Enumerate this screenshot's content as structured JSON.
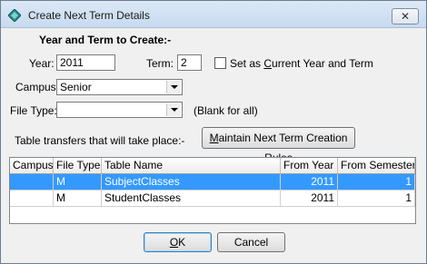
{
  "window": {
    "title": "Create Next Term Details",
    "close_label": "✕"
  },
  "form": {
    "heading": "Year and Term to Create:-",
    "year_label": "Year:",
    "year_value": "2011",
    "term_label": "Term:",
    "term_value": "2",
    "set_current_pre": "Set as ",
    "set_current_ul": "C",
    "set_current_post": "urrent Year and Term",
    "set_current_checked": false,
    "campus_label": "Campus:",
    "campus_value": "Senior",
    "filetype_label": "File Type:",
    "filetype_value": "",
    "filetype_hint": "(Blank for all)",
    "transfers_label": "Table transfers that will take place:-",
    "maintain_pre": "",
    "maintain_ul": "M",
    "maintain_post": "aintain Next Term Creation Rules"
  },
  "table": {
    "columns": [
      "Campus",
      "File Type",
      "Table Name",
      "From Year",
      "From Semester"
    ],
    "rows": [
      {
        "campus": "",
        "file_type": "M",
        "table_name": "SubjectClasses",
        "from_year": "2011",
        "from_semester": "1",
        "selected": true
      },
      {
        "campus": "",
        "file_type": "M",
        "table_name": "StudentClasses",
        "from_year": "2011",
        "from_semester": "1",
        "selected": false
      }
    ]
  },
  "buttons": {
    "ok_ul": "O",
    "ok_post": "K",
    "cancel": "Cancel"
  },
  "icons": {
    "app": "diamond-app-icon",
    "close": "close-icon",
    "dropdown": "chevron-down-icon"
  },
  "colors": {
    "selection": "#3399ff",
    "titlebar": "#c7daef"
  }
}
